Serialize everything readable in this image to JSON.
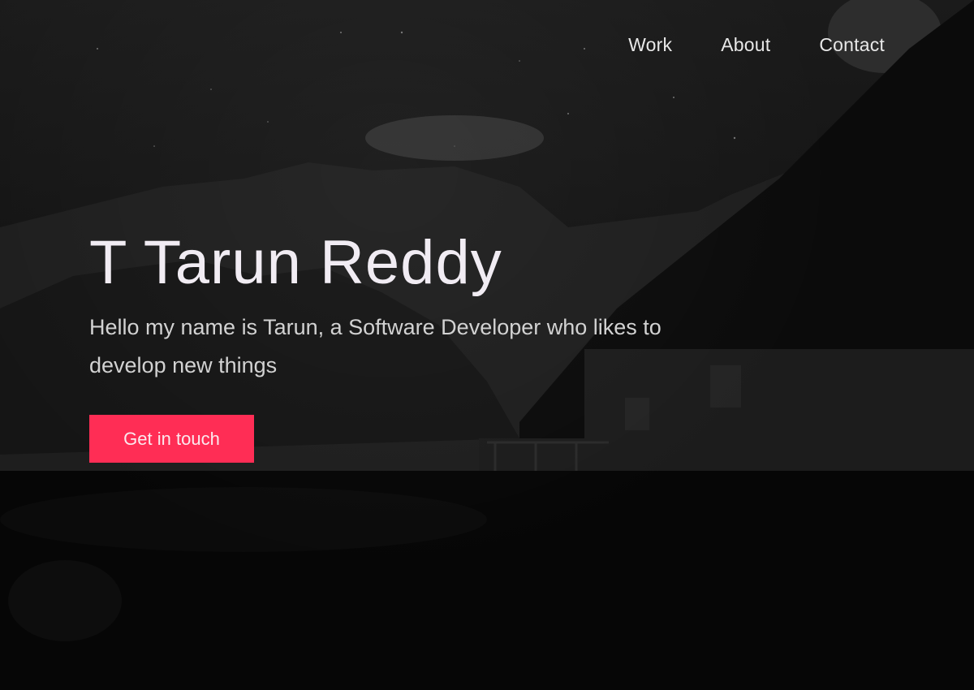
{
  "nav": {
    "items": [
      {
        "label": "Work"
      },
      {
        "label": "About"
      },
      {
        "label": "Contact"
      }
    ]
  },
  "hero": {
    "title": "T Tarun Reddy",
    "subtitle": "Hello my name is Tarun, a Software Developer who likes to develop new things",
    "cta_label": "Get in touch"
  },
  "colors": {
    "accent": "#ff2d55",
    "background": "#0a0a0a",
    "text": "#eeeeee"
  }
}
